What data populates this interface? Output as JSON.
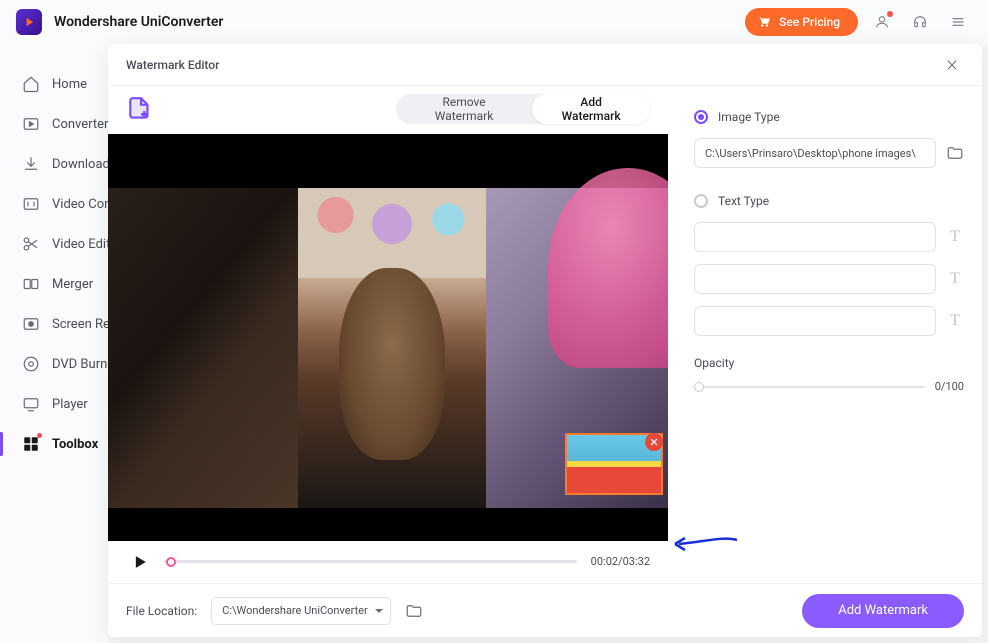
{
  "app": {
    "title": "Wondershare UniConverter"
  },
  "topbar": {
    "pricing_label": "See Pricing"
  },
  "sidebar": {
    "items": [
      {
        "label": "Home"
      },
      {
        "label": "Converter"
      },
      {
        "label": "Downloader"
      },
      {
        "label": "Video Compressor"
      },
      {
        "label": "Video Editor"
      },
      {
        "label": "Merger"
      },
      {
        "label": "Screen Recorder"
      },
      {
        "label": "DVD Burner"
      },
      {
        "label": "Player"
      },
      {
        "label": "Toolbox"
      }
    ]
  },
  "editor": {
    "title": "Watermark Editor",
    "tabs": {
      "remove": "Remove Watermark",
      "add": "Add Watermark"
    },
    "time": "00:02/03:32",
    "footer_label": "File Location:",
    "footer_path": "C:\\Wondershare UniConverter",
    "cta": "Add Watermark"
  },
  "panel": {
    "image_type_label": "Image Type",
    "image_path": "C:\\Users\\Prinsaro\\Desktop\\phone images\\",
    "text_type_label": "Text Type",
    "opacity_label": "Opacity",
    "opacity_value": "0/100"
  }
}
